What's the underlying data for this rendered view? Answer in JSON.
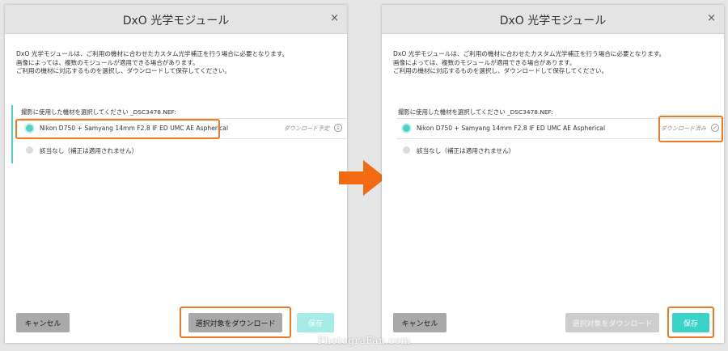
{
  "left": {
    "title": "DxO 光学モジュール",
    "close": "×",
    "description": [
      "DxO 光学モジュールは、ご利用の機材に合わせたカスタム光学補正を行う場合に必要となります。",
      "画像によっては、複数のモジュールが適用できる場合があります。",
      "ご利用の機材に対応するものを選択し、ダウンロードして保存してください。"
    ],
    "section_label": "撮影に使用した機材を選択してください _DSC3478.NEF:",
    "options": [
      {
        "label": "Nikon D750 + Samyang 14mm F2.8 IF ED UMC AE Aspherical",
        "status": "ダウンロード予定",
        "status_icon": "↓"
      },
      {
        "label": "該当なし（補正は適用されません）"
      }
    ],
    "buttons": {
      "cancel": "キャンセル",
      "download": "選択対象をダウンロード",
      "save": "保存"
    }
  },
  "right": {
    "title": "DxO 光学モジュール",
    "close": "×",
    "description": [
      "DxO 光学モジュールは、ご利用の機材に合わせたカスタム光学補正を行う場合に必要となります。",
      "画像によっては、複数のモジュールが適用できる場合があります。",
      "ご利用の機材に対応するものを選択し、ダウンロードして保存してください。"
    ],
    "section_label": "撮影に使用した機材を選択してください _DSC3478.NEF:",
    "options": [
      {
        "label": "Nikon D750 + Samyang 14mm F2.8 IF ED UMC AE Aspherical",
        "status": "ダウンロード済み",
        "status_icon": "✓"
      },
      {
        "label": "該当なし（補正は適用されません）"
      }
    ],
    "buttons": {
      "cancel": "キャンセル",
      "download": "選択対象をダウンロード",
      "save": "保存"
    }
  },
  "watermark": "PhotograFan.com",
  "colors": {
    "accent": "#4dd2c6",
    "highlight": "#f07a1f",
    "arrow": "#f26a12"
  }
}
